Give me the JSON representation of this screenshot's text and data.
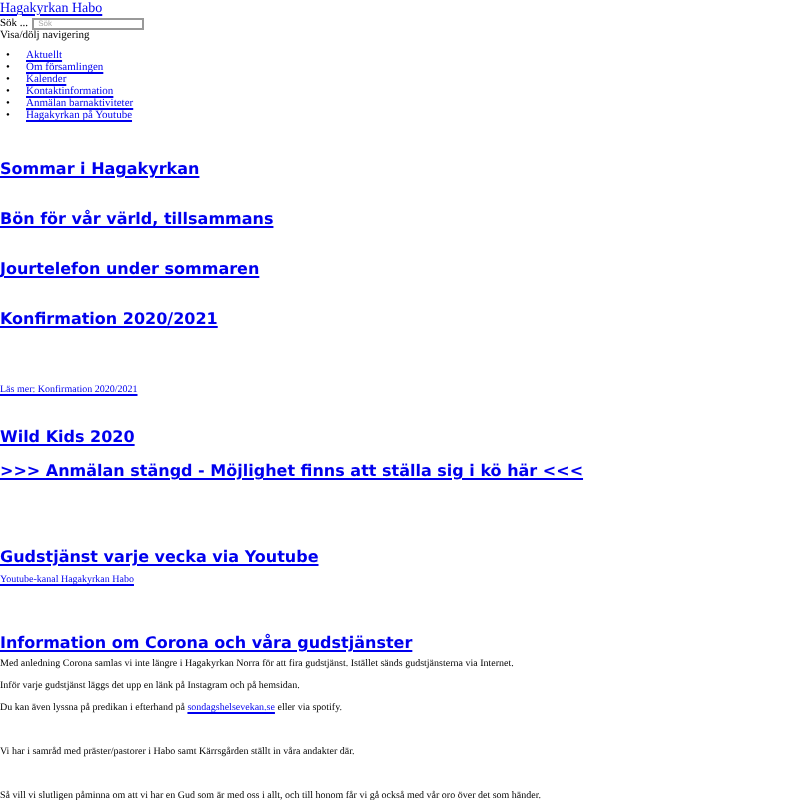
{
  "site_title": "Hagakyrkan Habo",
  "search": {
    "label": "Sök ...",
    "placeholder": "Sök"
  },
  "nav_toggle": "Visa/dölj navigering",
  "nav_items": [
    {
      "bullet": "•",
      "label": "Aktuellt"
    },
    {
      "bullet": "•",
      "label": "Om församlingen"
    },
    {
      "bullet": "•",
      "label": "Kalender"
    },
    {
      "bullet": "•",
      "label": "Kontaktinformation"
    },
    {
      "bullet": "•",
      "label": "Anmälan barnaktiviteter"
    },
    {
      "bullet": "•",
      "label": "Hagakyrkan på Youtube"
    }
  ],
  "posts": [
    {
      "title": "Sommar i Hagakyrkan"
    },
    {
      "title": "Bön för vår värld, tillsammans"
    },
    {
      "title": "Jourtelefon under sommaren"
    },
    {
      "title": "Konfirmation 2020/2021",
      "more_link": "Läs mer: Konfirmation 2020/2021"
    },
    {
      "title": "Wild Kids 2020",
      "subtitle": ">>> Anmälan stängd - Möjlighet finns att ställa sig i kö här <<<"
    },
    {
      "title": "Gudstjänst varje vecka via Youtube",
      "more_link": "Youtube-kanal Hagakyrkan Habo"
    },
    {
      "title": "Information om Corona och våra gudstjänster",
      "paragraphs": [
        {
          "text": "Med anledning Corona samlas vi inte längre i Hagakyrkan Norra för att fira gudstjänst. Istället sänds gudstjänsterna via Internet."
        },
        {
          "text": "Inför varje gudstjänst läggs det upp en länk på Instagram och på hemsidan."
        },
        {
          "text": "Du kan även lyssna på predikan i efterhand på ",
          "link": "sondagshelsevekan.se",
          "after": " eller via spotify."
        },
        {
          "text": "Vi har i samråd med präster/pastorer i Habo samt Kärrsgården ställt in våra andakter där."
        },
        {
          "text": "Så vill vi slutligen påminna om att vi har en Gud som är med oss i allt, och till honom får vi gå också med vår oro över det som händer."
        }
      ]
    }
  ]
}
